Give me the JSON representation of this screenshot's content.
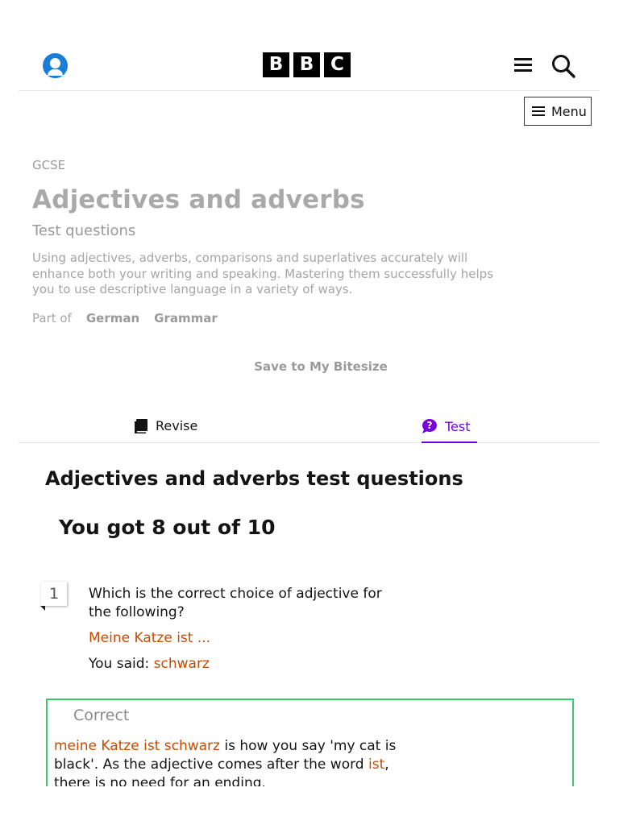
{
  "header": {
    "logo_letters": [
      "B",
      "B",
      "C"
    ],
    "menu_label": "Menu",
    "icons": [
      "account-icon",
      "hamburger-icon",
      "search-icon",
      "menu-lines-icon"
    ]
  },
  "hero": {
    "kicker": "GCSE",
    "title": "Adjectives and adverbs",
    "subtitle": "Test questions",
    "description": "Using adjectives, adverbs, comparisons and superlatives accurately will enhance both your writing and speaking. Mastering them successfully helps you to use descriptive language in a variety of ways.",
    "part_of_label": "Part of",
    "part_of_links": [
      "German",
      "Grammar"
    ],
    "save_label": "Save to My Bitesize"
  },
  "tabs": [
    {
      "label": "Revise",
      "icon": "book-icon",
      "active": false
    },
    {
      "label": "Test",
      "icon": "question-icon",
      "active": true
    }
  ],
  "content": {
    "section_title": "Adjectives and adverbs test questions",
    "score": "You got 8 out of 10",
    "question": {
      "number": "1",
      "text": "Which is the correct choice of adjective for the following?",
      "example": "Meine Katze ist ...",
      "answer_prefix": "You said:",
      "answer_value": "schwarz"
    },
    "feedback": {
      "status": "Correct",
      "phrase": "meine Katze ist schwarz",
      "text_1": " is how you say 'my cat is black'. As the adjective comes after the word ",
      "keyword": "ist",
      "text_2": ", there is no need for an ending."
    }
  },
  "colors": {
    "accent_purple": "#7a00d9",
    "highlight_orange": "#c84a00",
    "correct_green": "#3cc96d",
    "account_blue": "#1a7dd8"
  }
}
